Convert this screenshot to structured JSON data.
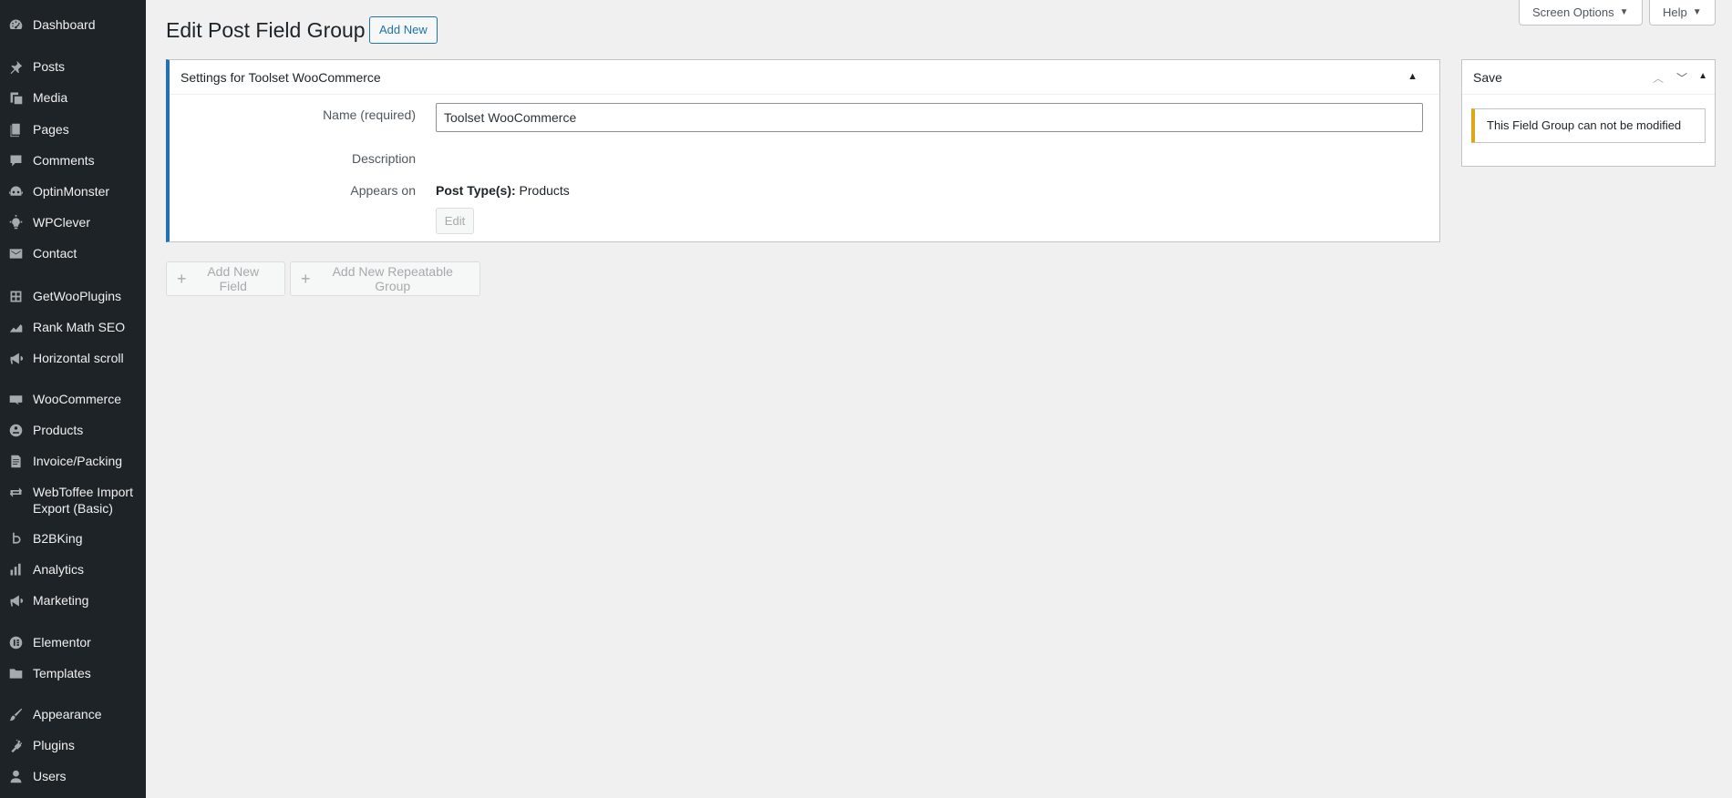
{
  "sidebar": {
    "items": [
      {
        "label": "Dashboard",
        "icon": "dashboard-icon"
      },
      {
        "label": "Posts",
        "icon": "pin-icon"
      },
      {
        "label": "Media",
        "icon": "media-icon"
      },
      {
        "label": "Pages",
        "icon": "pages-icon"
      },
      {
        "label": "Comments",
        "icon": "comment-icon"
      },
      {
        "label": "OptinMonster",
        "icon": "optinmonster-icon"
      },
      {
        "label": "WPClever",
        "icon": "lightbulb-icon"
      },
      {
        "label": "Contact",
        "icon": "mail-icon"
      },
      {
        "label": "GetWooPlugins",
        "icon": "grid-icon"
      },
      {
        "label": "Rank Math SEO",
        "icon": "chart-icon"
      },
      {
        "label": "Horizontal scroll",
        "icon": "megaphone-icon"
      },
      {
        "label": "WooCommerce",
        "icon": "woo-icon"
      },
      {
        "label": "Products",
        "icon": "archive-icon"
      },
      {
        "label": "Invoice/Packing",
        "icon": "document-icon"
      },
      {
        "label": "WebToffee Import Export (Basic)",
        "icon": "arrows-icon"
      },
      {
        "label": "B2BKing",
        "icon": "b2bking-icon"
      },
      {
        "label": "Analytics",
        "icon": "bar-chart-icon"
      },
      {
        "label": "Marketing",
        "icon": "megaphone-icon"
      },
      {
        "label": "Elementor",
        "icon": "elementor-icon"
      },
      {
        "label": "Templates",
        "icon": "folder-icon"
      },
      {
        "label": "Appearance",
        "icon": "brush-icon"
      },
      {
        "label": "Plugins",
        "icon": "plugin-icon"
      },
      {
        "label": "Users",
        "icon": "user-icon"
      }
    ]
  },
  "header": {
    "title": "Edit Post Field Group",
    "add_new": "Add New",
    "screen_options": "Screen Options",
    "help": "Help"
  },
  "settings": {
    "title": "Settings for Toolset WooCommerce",
    "name_label": "Name (required)",
    "name_value": "Toolset WooCommerce",
    "description_label": "Description",
    "appears_on_label": "Appears on",
    "post_types_label": "Post Type(s):",
    "post_types_value": "Products",
    "edit_button": "Edit"
  },
  "actions": {
    "add_field": "Add New Field",
    "add_repeatable_group": "Add New Repeatable Group"
  },
  "save": {
    "title": "Save",
    "notice": "This Field Group can not be modified"
  },
  "colors": {
    "sidebar_bg": "#1d2327",
    "accent": "#2271b1",
    "warning": "#dba617"
  }
}
